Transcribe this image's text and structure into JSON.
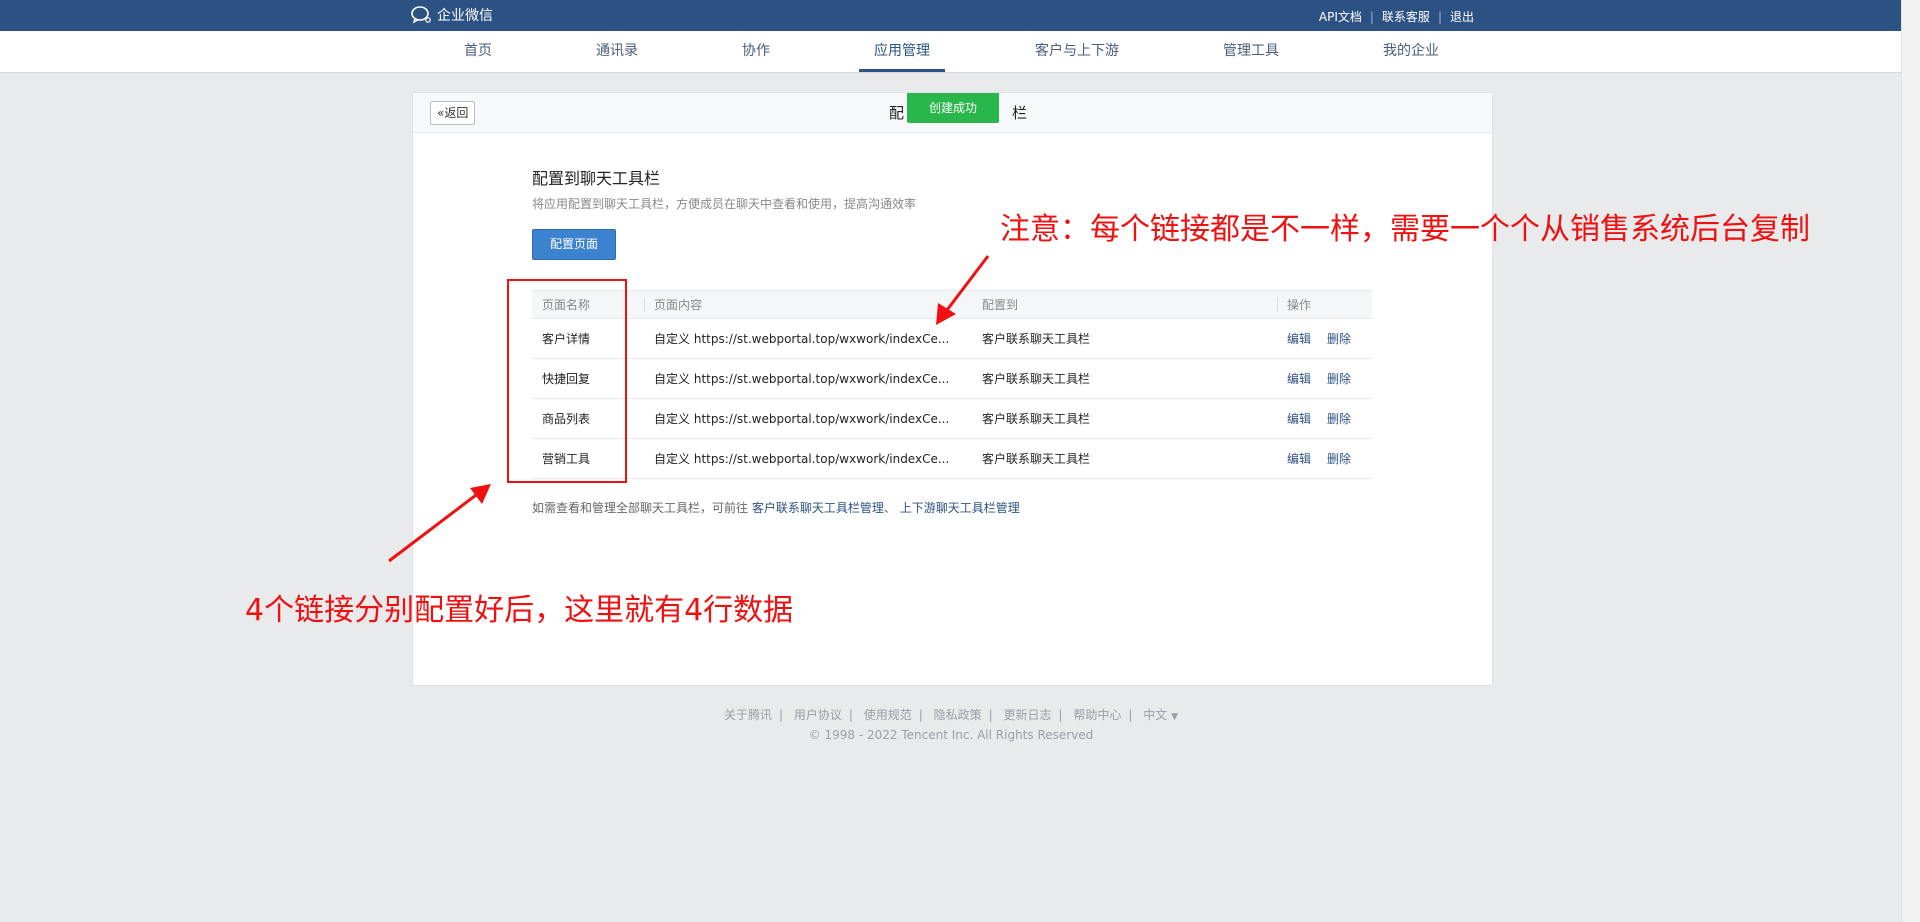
{
  "topbar": {
    "brand": "企业微信",
    "links": [
      "API文档",
      "联系客服",
      "退出"
    ]
  },
  "nav": {
    "items": [
      "首页",
      "通讯录",
      "协作",
      "应用管理",
      "客户与上下游",
      "管理工具",
      "我的企业"
    ],
    "active": "应用管理"
  },
  "panel": {
    "back_label": "返回",
    "title_left": "配",
    "title_right": "栏",
    "toast": "创建成功"
  },
  "section": {
    "title": "配置到聊天工具栏",
    "desc": "将应用配置到聊天工具栏，方便成员在聊天中查看和使用，提高沟通效率",
    "config_button": "配置页面"
  },
  "table": {
    "headers": [
      "页面名称",
      "页面内容",
      "配置到",
      "操作"
    ],
    "rows": [
      {
        "name": "客户详情",
        "content": "自定义 https://st.webportal.top/wxwork/indexCe...",
        "target": "客户联系聊天工具栏",
        "edit": "编辑",
        "delete": "删除"
      },
      {
        "name": "快捷回复",
        "content": "自定义 https://st.webportal.top/wxwork/indexCe...",
        "target": "客户联系聊天工具栏",
        "edit": "编辑",
        "delete": "删除"
      },
      {
        "name": "商品列表",
        "content": "自定义 https://st.webportal.top/wxwork/indexCe...",
        "target": "客户联系聊天工具栏",
        "edit": "编辑",
        "delete": "删除"
      },
      {
        "name": "营销工具",
        "content": "自定义 https://st.webportal.top/wxwork/indexCe...",
        "target": "客户联系聊天工具栏",
        "edit": "编辑",
        "delete": "删除"
      }
    ]
  },
  "foot_note": {
    "text": "如需查看和管理全部聊天工具栏，可前往",
    "link1": "客户联系聊天工具栏管理",
    "sep": "、",
    "link2": "上下游聊天工具栏管理"
  },
  "footer": {
    "links": [
      "关于腾讯",
      "用户协议",
      "使用规范",
      "隐私政策",
      "更新日志",
      "帮助中心"
    ],
    "lang": "中文",
    "copyright": "© 1998 - 2022 Tencent Inc. All Rights Reserved"
  },
  "annotations": {
    "top_note": "注意：每个链接都是不一样，需要一个个从销售系统后台复制",
    "bottom_note": "4个链接分别配置好后，这里就有4行数据",
    "color": "#f01010"
  }
}
